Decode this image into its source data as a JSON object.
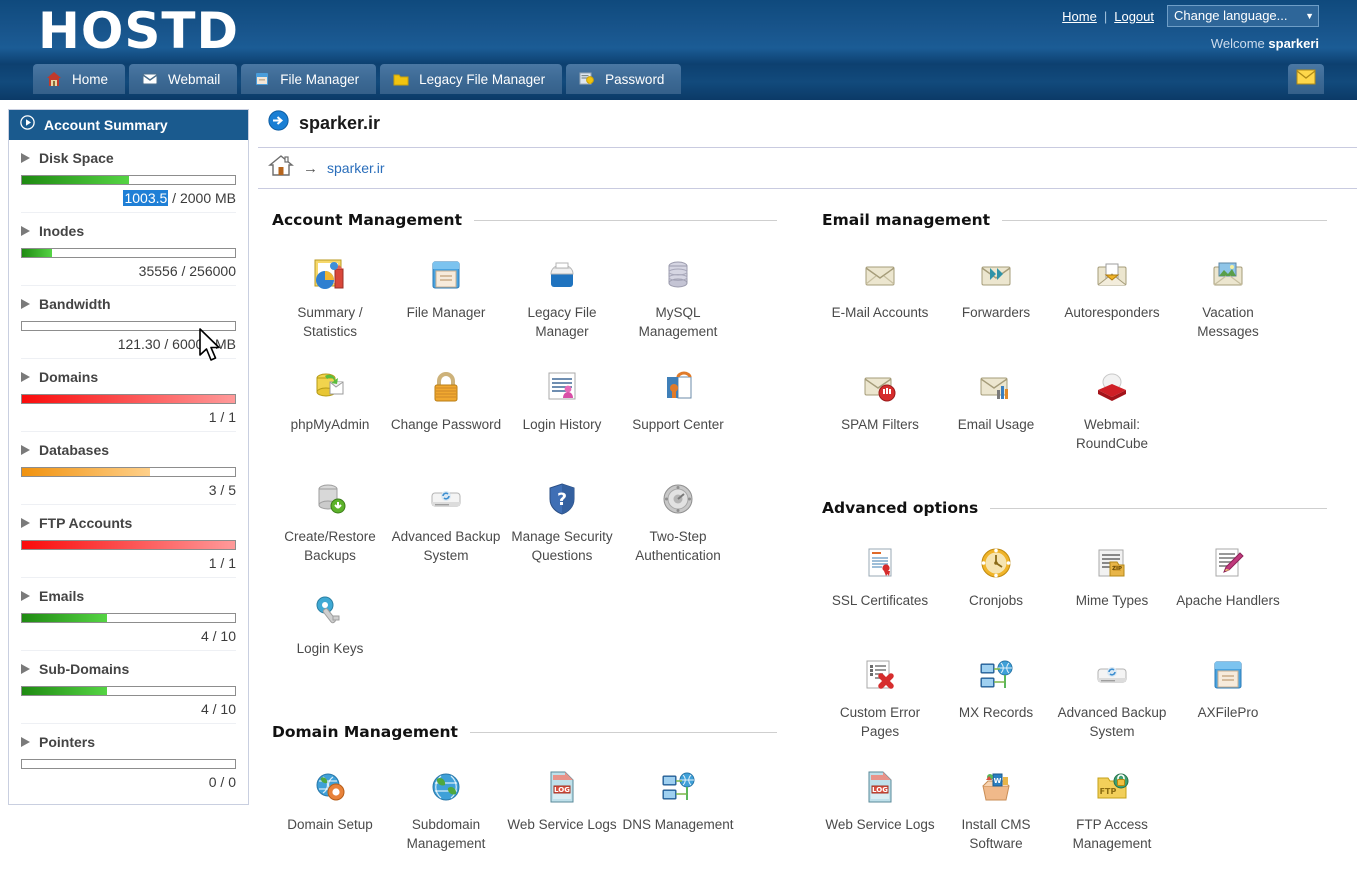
{
  "header": {
    "logo": "HOSTD",
    "home_link": "Home",
    "separator": "|",
    "logout_link": "Logout",
    "language_select": "Change language...",
    "welcome_prefix": "Welcome",
    "welcome_user": "sparkeri",
    "mail_icon": "envelope-icon"
  },
  "tabs": [
    {
      "label": "Home",
      "icon": "house-icon"
    },
    {
      "label": "Webmail",
      "icon": "envelope-icon"
    },
    {
      "label": "File Manager",
      "icon": "file-drawer-icon"
    },
    {
      "label": "Legacy File Manager",
      "icon": "folder-icon"
    },
    {
      "label": "Password",
      "icon": "password-key-icon"
    }
  ],
  "sidebar": {
    "title": "Account Summary",
    "title_icon": "circle-play-icon",
    "items": [
      {
        "label": "Disk Space",
        "value_prefix": "1003.5",
        "value_suffix": " / 2000 MB",
        "highlight": true,
        "percent": 50,
        "color": "green"
      },
      {
        "label": "Inodes",
        "value_prefix": "",
        "value_suffix": "35556 / 256000",
        "highlight": false,
        "percent": 14,
        "color": "green"
      },
      {
        "label": "Bandwidth",
        "value_prefix": "",
        "value_suffix": "121.30 / 60000 MB",
        "highlight": false,
        "percent": 0,
        "color": "green"
      },
      {
        "label": "Domains",
        "value_prefix": "",
        "value_suffix": "1 / 1",
        "highlight": false,
        "percent": 100,
        "color": "red"
      },
      {
        "label": "Databases",
        "value_prefix": "",
        "value_suffix": "3 / 5",
        "highlight": false,
        "percent": 60,
        "color": "orange"
      },
      {
        "label": "FTP Accounts",
        "value_prefix": "",
        "value_suffix": "1 / 1",
        "highlight": false,
        "percent": 100,
        "color": "red"
      },
      {
        "label": "Emails",
        "value_prefix": "",
        "value_suffix": "4 / 10",
        "highlight": false,
        "percent": 40,
        "color": "green"
      },
      {
        "label": "Sub-Domains",
        "value_prefix": "",
        "value_suffix": "4 / 10",
        "highlight": false,
        "percent": 40,
        "color": "green"
      },
      {
        "label": "Pointers",
        "value_prefix": "",
        "value_suffix": "0 / 0",
        "highlight": false,
        "percent": 0,
        "color": "green"
      }
    ]
  },
  "main": {
    "page_title": "sparker.ir",
    "page_title_icon": "blue-arrow-circle-icon",
    "breadcrumb": {
      "home_icon": "home-icon",
      "arrow": "→",
      "current": "sparker.ir"
    }
  },
  "sections": [
    {
      "id": "account-management",
      "title": "Account Management",
      "column": "left",
      "items": [
        {
          "label": "Summary / Statistics",
          "icon": "chart-pie-icon"
        },
        {
          "label": "File Manager",
          "icon": "file-drawer-icon"
        },
        {
          "label": "Legacy File Manager",
          "icon": "card-box-icon"
        },
        {
          "label": "MySQL Management",
          "icon": "database-icon"
        },
        {
          "label": "phpMyAdmin",
          "icon": "phpmyadmin-icon"
        },
        {
          "label": "Change Password",
          "icon": "padlock-icon"
        },
        {
          "label": "Login History",
          "icon": "document-user-icon"
        },
        {
          "label": "Support Center",
          "icon": "support-book-icon"
        },
        {
          "label": "Create/Restore Backups",
          "icon": "backup-download-icon"
        },
        {
          "label": "Advanced Backup System",
          "icon": "harddrive-sync-icon"
        },
        {
          "label": "Manage Security Questions",
          "icon": "shield-question-icon"
        },
        {
          "label": "Two-Step Authentication",
          "icon": "dial-lock-icon"
        },
        {
          "label": "Login Keys",
          "icon": "key-icon"
        }
      ]
    },
    {
      "id": "domain-management",
      "title": "Domain Management",
      "column": "left",
      "items": [
        {
          "label": "Domain Setup",
          "icon": "globe-gear-icon"
        },
        {
          "label": "Subdomain Management",
          "icon": "globe-icon"
        },
        {
          "label": "Web Service Logs",
          "icon": "log-file-icon"
        },
        {
          "label": "DNS Management",
          "icon": "network-globe-icon"
        }
      ]
    },
    {
      "id": "email-management",
      "title": "Email management",
      "column": "right",
      "items": [
        {
          "label": "E-Mail Accounts",
          "icon": "envelope-icon"
        },
        {
          "label": "Forwarders",
          "icon": "envelope-forward-icon"
        },
        {
          "label": "Autoresponders",
          "icon": "envelope-open-icon"
        },
        {
          "label": "Vacation Messages",
          "icon": "envelope-photo-icon"
        },
        {
          "label": "SPAM Filters",
          "icon": "envelope-block-icon"
        },
        {
          "label": "Email Usage",
          "icon": "envelope-chart-icon"
        },
        {
          "label": "Webmail: RoundCube",
          "icon": "roundcube-icon"
        }
      ]
    },
    {
      "id": "advanced-options",
      "title": "Advanced options",
      "column": "right",
      "items": [
        {
          "label": "SSL Certificates",
          "icon": "certificate-icon"
        },
        {
          "label": "Cronjobs",
          "icon": "clock-icon"
        },
        {
          "label": "Mime Types",
          "icon": "zip-file-icon"
        },
        {
          "label": "Apache Handlers",
          "icon": "document-pen-icon"
        },
        {
          "label": "Custom Error Pages",
          "icon": "document-error-icon"
        },
        {
          "label": "MX Records",
          "icon": "network-globe-icon"
        },
        {
          "label": "Advanced Backup System",
          "icon": "harddrive-sync-icon"
        },
        {
          "label": "AXFilePro",
          "icon": "file-drawer-icon"
        },
        {
          "label": "Web Service Logs",
          "icon": "log-file-icon"
        },
        {
          "label": "Install CMS Software",
          "icon": "cms-box-icon"
        },
        {
          "label": "FTP Access Management",
          "icon": "ftp-folder-lock-icon"
        }
      ]
    }
  ],
  "colors": {
    "header_blue": "#18548b",
    "sidebar_head": "#1a5a8e",
    "link_blue": "#2a6ebb",
    "highlight_blue": "#1f7fd6",
    "green": "#55d444",
    "orange": "#f0920f",
    "red": "#fa0b0b"
  }
}
